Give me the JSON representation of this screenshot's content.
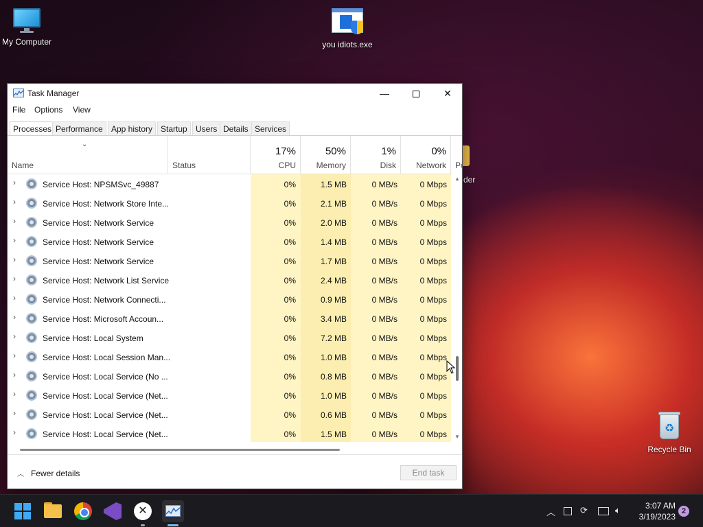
{
  "desktop": {
    "icons": [
      {
        "label": "My Computer"
      },
      {
        "label": "you idiots.exe"
      },
      {
        "label": "Recycle Bin"
      }
    ],
    "peek_label": "der"
  },
  "window": {
    "title": "Task Manager",
    "controls": {
      "minimize": "—",
      "close": "✕"
    },
    "menu": [
      "File",
      "Options",
      "View"
    ],
    "tabs": [
      "Processes",
      "Performance",
      "App history",
      "Startup",
      "Users",
      "Details",
      "Services"
    ],
    "active_tab": "Processes",
    "columns": {
      "name": "Name",
      "status": "Status",
      "cpu": {
        "pct": "17%",
        "label": "CPU"
      },
      "memory": {
        "pct": "50%",
        "label": "Memory"
      },
      "disk": {
        "pct": "1%",
        "label": "Disk"
      },
      "network": {
        "pct": "0%",
        "label": "Network"
      },
      "power_partial": "Po"
    },
    "rows": [
      {
        "name": "Service Host: NPSMSvc_49887",
        "cpu": "0%",
        "memory": "1.5 MB",
        "disk": "0 MB/s",
        "network": "0 Mbps"
      },
      {
        "name": "Service Host: Network Store Inte...",
        "cpu": "0%",
        "memory": "2.1 MB",
        "disk": "0 MB/s",
        "network": "0 Mbps"
      },
      {
        "name": "Service Host: Network Service",
        "cpu": "0%",
        "memory": "2.0 MB",
        "disk": "0 MB/s",
        "network": "0 Mbps"
      },
      {
        "name": "Service Host: Network Service",
        "cpu": "0%",
        "memory": "1.4 MB",
        "disk": "0 MB/s",
        "network": "0 Mbps"
      },
      {
        "name": "Service Host: Network Service",
        "cpu": "0%",
        "memory": "1.7 MB",
        "disk": "0 MB/s",
        "network": "0 Mbps"
      },
      {
        "name": "Service Host: Network List Service",
        "cpu": "0%",
        "memory": "2.4 MB",
        "disk": "0 MB/s",
        "network": "0 Mbps"
      },
      {
        "name": "Service Host: Network Connecti...",
        "cpu": "0%",
        "memory": "0.9 MB",
        "disk": "0 MB/s",
        "network": "0 Mbps"
      },
      {
        "name": "Service Host: Microsoft Accoun...",
        "cpu": "0%",
        "memory": "3.4 MB",
        "disk": "0 MB/s",
        "network": "0 Mbps"
      },
      {
        "name": "Service Host: Local System",
        "cpu": "0%",
        "memory": "7.2 MB",
        "disk": "0 MB/s",
        "network": "0 Mbps"
      },
      {
        "name": "Service Host: Local Session Man...",
        "cpu": "0%",
        "memory": "1.0 MB",
        "disk": "0 MB/s",
        "network": "0 Mbps"
      },
      {
        "name": "Service Host: Local Service (No ...",
        "cpu": "0%",
        "memory": "0.8 MB",
        "disk": "0 MB/s",
        "network": "0 Mbps"
      },
      {
        "name": "Service Host: Local Service (Net...",
        "cpu": "0%",
        "memory": "1.0 MB",
        "disk": "0 MB/s",
        "network": "0 Mbps"
      },
      {
        "name": "Service Host: Local Service (Net...",
        "cpu": "0%",
        "memory": "0.6 MB",
        "disk": "0 MB/s",
        "network": "0 Mbps"
      },
      {
        "name": "Service Host: Local Service (Net...",
        "cpu": "0%",
        "memory": "1.5 MB",
        "disk": "0 MB/s",
        "network": "0 Mbps"
      }
    ],
    "footer": {
      "fewer_details": "Fewer details",
      "end_task": "End task"
    }
  },
  "taskbar": {
    "apps": [
      "start-icon",
      "file-explorer-icon",
      "chrome-icon",
      "visual-studio-icon",
      "xbox-icon",
      "task-manager-icon"
    ],
    "tray": {
      "time": "3:07 AM",
      "date": "3/19/2023",
      "notifications": "2"
    }
  },
  "colors": {
    "heat_light": "#fff4c4",
    "heat_mid": "#fbeeb0",
    "accent": "#76b9ed"
  }
}
